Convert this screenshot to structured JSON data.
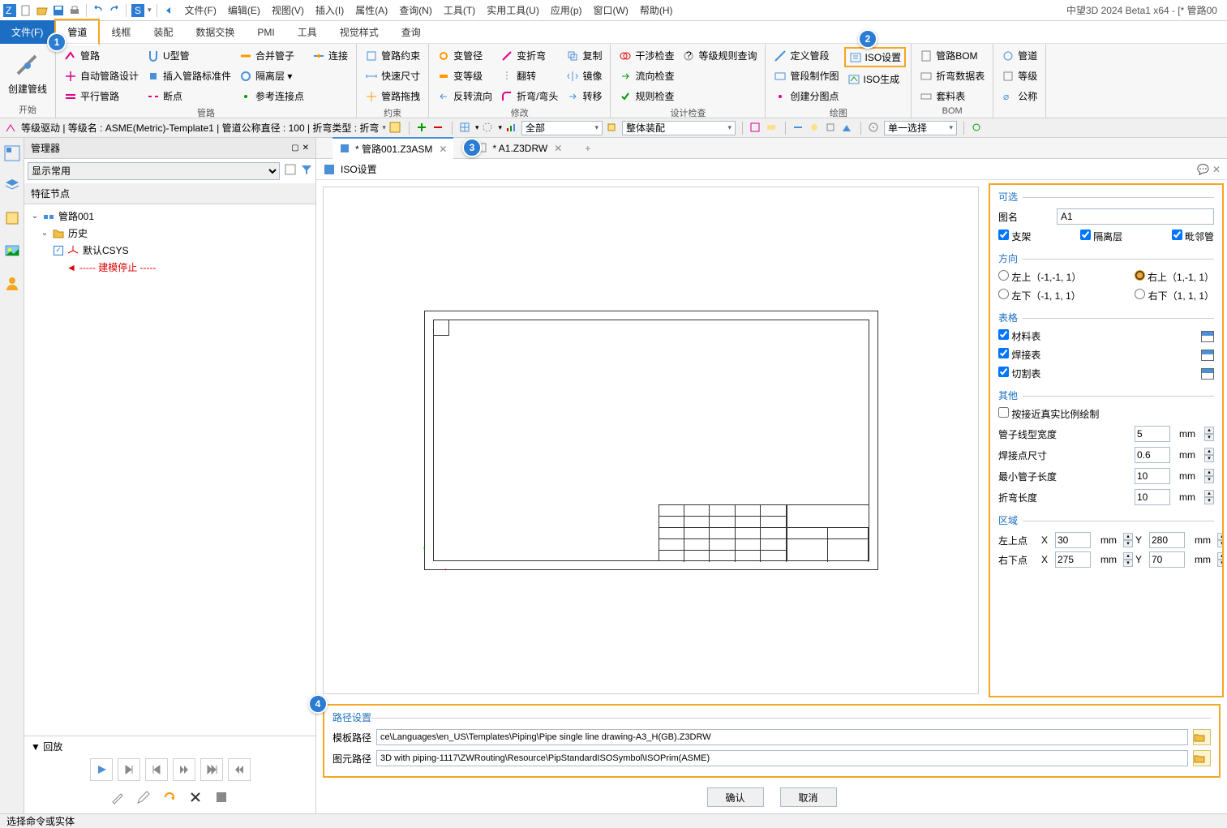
{
  "app_title": "中望3D 2024 Beta1 x64 - [* 管路00",
  "menu": [
    "文件(F)",
    "编辑(E)",
    "视图(V)",
    "插入(I)",
    "属性(A)",
    "查询(N)",
    "工具(T)",
    "实用工具(U)",
    "应用(p)",
    "窗口(W)",
    "帮助(H)"
  ],
  "ribbon_tabs": {
    "file": "文件(F)",
    "items": [
      "管道",
      "线框",
      "装配",
      "数据交换",
      "PMI",
      "工具",
      "视觉样式",
      "查询"
    ],
    "active": "管道"
  },
  "callouts": {
    "c1": "1",
    "c2": "2",
    "c3": "3",
    "c4": "4"
  },
  "ribbon": {
    "start": {
      "label": "开始",
      "big": "创建管线"
    },
    "routes": {
      "label": "管路",
      "c1": [
        "管路",
        "自动管路设计",
        "平行管路"
      ],
      "c2": [
        "U型管",
        "插入管路标准件",
        "断点"
      ],
      "c3": [
        "合并管子",
        "隔离层 ▾",
        "参考连接点"
      ],
      "c4": [
        "连接"
      ]
    },
    "constraint": {
      "label": "约束",
      "c1": [
        "管路约束",
        "快速尺寸",
        "管路拖拽"
      ]
    },
    "modify": {
      "label": "修改",
      "c1": [
        "变管径",
        "变等级",
        "反转流向"
      ],
      "c2": [
        "变折弯",
        "翻转",
        "折弯/弯头"
      ],
      "c3": [
        "复制",
        "镜像",
        "转移"
      ]
    },
    "check": {
      "label": "设计检查",
      "c1": [
        "干涉检查",
        "流向检查",
        "规则检查"
      ],
      "c2": [
        "等级规则查询"
      ]
    },
    "draw": {
      "label": "绘图",
      "c1": [
        "定义管段",
        "管段制作图",
        "创建分图点"
      ],
      "c2": [
        "ISO设置",
        "ISO生成"
      ]
    },
    "bom": {
      "label": "BOM",
      "c1": [
        "管路BOM",
        "折弯数据表",
        "套料表"
      ],
      "c2": [
        "管道",
        "等级",
        "公称"
      ]
    }
  },
  "subbar": {
    "text1": "等级驱动 | 等级名 : ASME(Metric)-Template1 | 管道公称直径 : 100 | 折弯类型 : 折弯",
    "combo1": "全部",
    "combo2": "整体装配",
    "combo3": "单一选择"
  },
  "manager": {
    "title": "管理器",
    "filter": "显示常用",
    "tree_header": "特征节点",
    "root": "管路001",
    "history": "历史",
    "csys": "默认CSYS",
    "stop": "----- 建模停止 -----",
    "replay": "▼ 回放"
  },
  "doc_tabs": {
    "t1": "* 管路001.Z3ASM",
    "t2": "* A1.Z3DRW"
  },
  "iso": {
    "title": "ISO设置",
    "optional_legend": "可选",
    "name_label": "图名",
    "name_value": "A1",
    "chk_bracket": "支架",
    "chk_iso": "隔离层",
    "chk_adj": "毗邻管",
    "dir_legend": "方向",
    "dir_ul": "左上（-1,-1, 1）",
    "dir_ur": "右上（1,-1, 1）",
    "dir_bl": "左下（-1, 1, 1）",
    "dir_br": "右下（1, 1, 1）",
    "table_legend": "表格",
    "tbl_material": "材料表",
    "tbl_weld": "焊接表",
    "tbl_cut": "切割表",
    "other_legend": "其他",
    "chk_scale": "按接近真实比例绘制",
    "lbl_linewidth": "管子线型宽度",
    "val_linewidth": "5",
    "lbl_weldsize": "焊接点尺寸",
    "val_weldsize": "0.6",
    "lbl_minlen": "最小管子长度",
    "val_minlen": "10",
    "lbl_bendlen": "折弯长度",
    "val_bendlen": "10",
    "region_legend": "区域",
    "lbl_ul": "左上点",
    "lbl_br": "右下点",
    "ul_x": "30",
    "ul_y": "280",
    "br_x": "275",
    "br_y": "70",
    "unit": "mm",
    "X": "X",
    "Y": "Y"
  },
  "paths": {
    "legend": "路径设置",
    "lbl_template": "模板路径",
    "val_template": "ce\\Languages\\en_US\\Templates\\Piping\\Pipe single line drawing-A3_H(GB).Z3DRW",
    "lbl_prim": "图元路径",
    "val_prim": "3D with piping-1117\\ZWRouting\\Resource\\PipStandardISOSymbol\\ISOPrim(ASME)"
  },
  "buttons": {
    "ok": "确认",
    "cancel": "取消"
  },
  "status": "选择命令或实体"
}
